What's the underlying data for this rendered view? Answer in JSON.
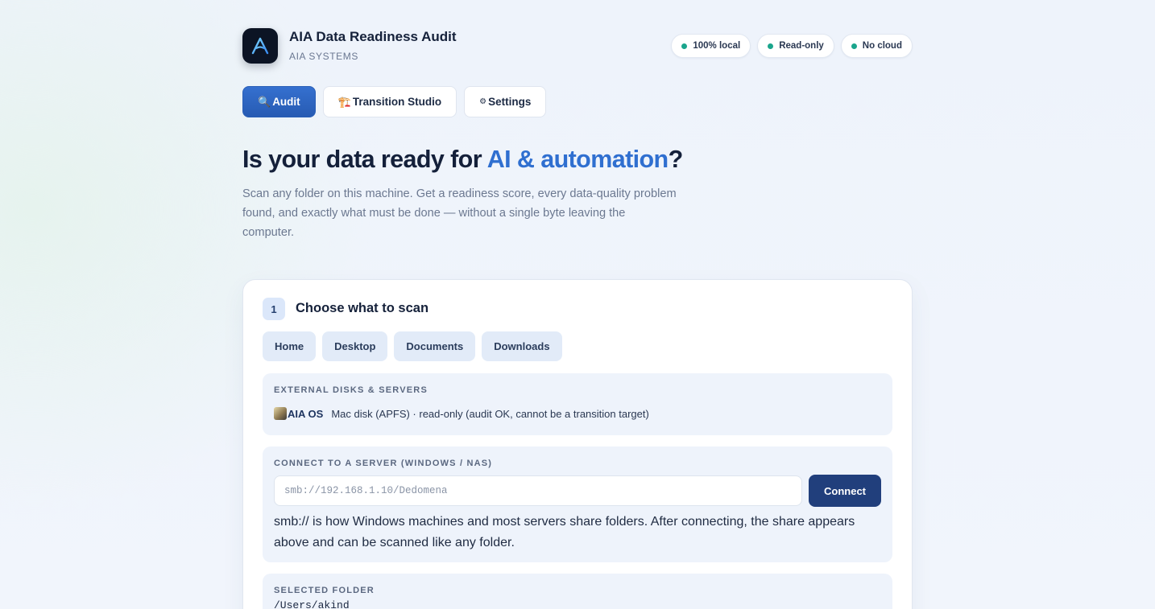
{
  "app": {
    "title": "AIA Data Readiness Audit",
    "subtitle": "AIA SYSTEMS",
    "logo_icon": "aia-logo-icon"
  },
  "badges": [
    "100% local",
    "Read-only",
    "No cloud"
  ],
  "tabs": [
    {
      "icon": "🔍",
      "label": "Audit",
      "active": true
    },
    {
      "icon": "🏗️",
      "label": "Transition Studio",
      "active": false
    },
    {
      "icon": "⚙",
      "label": "Settings",
      "active": false
    }
  ],
  "hero": {
    "title_prefix": "Is your data ready for ",
    "title_accent": "AI & automation",
    "title_suffix": "?",
    "description": "Scan any folder on this machine. Get a readiness score, every data-quality problem found, and exactly what must be done — without a single byte leaving the computer."
  },
  "step": {
    "number": "1",
    "title": "Choose what to scan",
    "quick_folders": [
      "Home",
      "Desktop",
      "Documents",
      "Downloads"
    ]
  },
  "external": {
    "label": "EXTERNAL DISKS & SERVERS",
    "disk_name": "AIA OS",
    "disk_desc": "Mac disk (APFS) · read-only (audit OK, cannot be a transition target)"
  },
  "server": {
    "label": "CONNECT TO A SERVER (WINDOWS / NAS)",
    "placeholder": "smb://192.168.1.10/Dedomena",
    "connect_label": "Connect",
    "help": "smb:// is how Windows machines and most servers share folders. After connecting, the share appears above and can be scanned like any folder."
  },
  "selected": {
    "label": "SELECTED FOLDER",
    "path": "/Users/akind"
  },
  "colors": {
    "accent": "#2f6fd0",
    "primary_button": "#213f7c",
    "status_dot": "#1aa58c"
  }
}
